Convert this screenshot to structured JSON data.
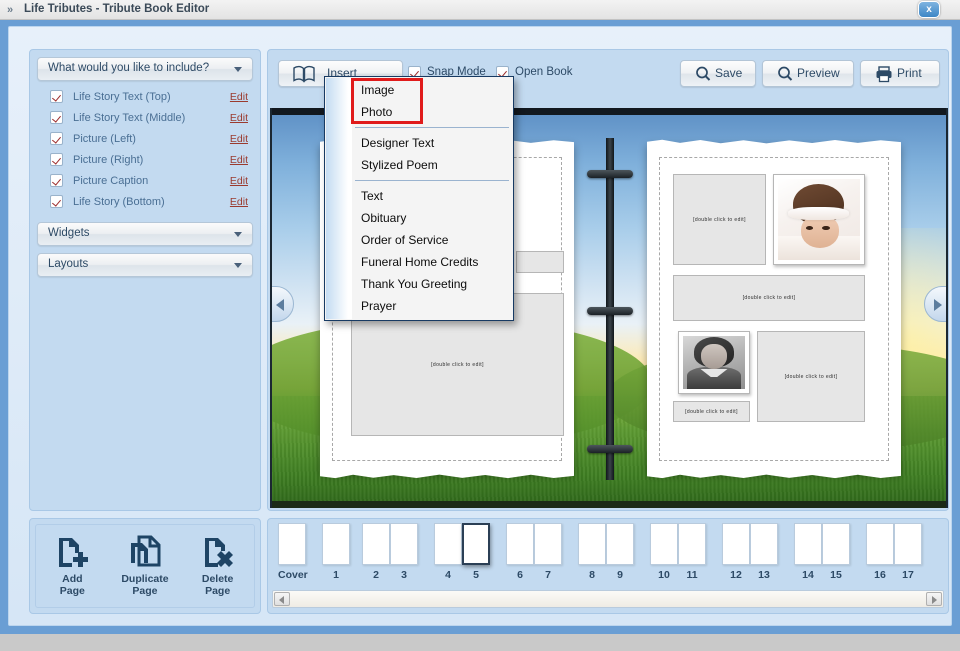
{
  "window": {
    "title": "Life Tributes - Tribute Book Editor",
    "chevrons": "»",
    "close_label": "x"
  },
  "sidebar": {
    "include_header": "What would you like to include?",
    "widgets_header": "Widgets",
    "layouts_header": "Layouts",
    "edit_label": "Edit",
    "items": [
      {
        "label": "Life Story Text (Top)",
        "checked": true
      },
      {
        "label": "Life Story Text (Middle)",
        "checked": true
      },
      {
        "label": "Picture (Left)",
        "checked": true
      },
      {
        "label": "Picture (Right)",
        "checked": true
      },
      {
        "label": "Picture Caption",
        "checked": true
      },
      {
        "label": "Life Story (Bottom)",
        "checked": true
      }
    ]
  },
  "page_actions": [
    {
      "line1": "Add",
      "line2": "Page",
      "icon": "page-plus-icon"
    },
    {
      "line1": "Duplicate",
      "line2": "Page",
      "icon": "page-copy-icon"
    },
    {
      "line1": "Delete",
      "line2": "Page",
      "icon": "page-delete-icon"
    }
  ],
  "toolbar": {
    "insert_label": "Insert",
    "snap_mode_label": "Snap Mode",
    "snap_mode_checked": true,
    "open_book_label": "Open Book",
    "open_book_checked": true,
    "save_label": "Save",
    "preview_label": "Preview",
    "print_label": "Print"
  },
  "insert_menu": {
    "open": true,
    "highlight_color": "#e01b1b",
    "groups": [
      [
        "Image",
        "Photo"
      ],
      [
        "Designer Text",
        "Stylized Poem"
      ],
      [
        "Text",
        "Obituary",
        "Order of Service",
        "Funeral Home Credits",
        "Thank You Greeting",
        "Prayer"
      ]
    ],
    "items": [
      "Image",
      "Photo",
      "Designer Text",
      "Stylized Poem",
      "Text",
      "Obituary",
      "Order of Service",
      "Funeral Home Credits",
      "Thank You Greeting",
      "Prayer"
    ]
  },
  "canvas": {
    "placeholder_text": "[double click to edit]",
    "left_page": {
      "boxes": [
        {
          "name": "small-text-box",
          "text": ""
        },
        {
          "name": "large-text-box",
          "text": "[double click to edit]"
        }
      ]
    },
    "right_page": {
      "boxes": [
        {
          "name": "text-box-top-left",
          "text": "[double click to edit]"
        },
        {
          "name": "photo-baby",
          "text": ""
        },
        {
          "name": "text-box-middle",
          "text": "[double click to edit]"
        },
        {
          "name": "photo-lady",
          "text": ""
        },
        {
          "name": "caption-box",
          "text": "[double click to edit]"
        },
        {
          "name": "text-box-bottom-right",
          "text": "[double click to edit]"
        }
      ]
    },
    "prev_arrow": "◀",
    "next_arrow": "▶"
  },
  "navigator": {
    "selected_page": "5",
    "thumbs": [
      {
        "label": "Cover",
        "selected": false
      },
      {
        "label": "1",
        "selected": false
      },
      {
        "label": "2",
        "selected": false
      },
      {
        "label": "3",
        "selected": false
      },
      {
        "label": "4",
        "selected": false
      },
      {
        "label": "5",
        "selected": true
      },
      {
        "label": "6",
        "selected": false
      },
      {
        "label": "7",
        "selected": false
      },
      {
        "label": "8",
        "selected": false
      },
      {
        "label": "9",
        "selected": false
      },
      {
        "label": "10",
        "selected": false
      },
      {
        "label": "11",
        "selected": false
      },
      {
        "label": "12",
        "selected": false
      },
      {
        "label": "13",
        "selected": false
      },
      {
        "label": "14",
        "selected": false
      },
      {
        "label": "15",
        "selected": false
      },
      {
        "label": "16",
        "selected": false
      },
      {
        "label": "17",
        "selected": false
      }
    ]
  },
  "colors": {
    "panel": "#c3daf0",
    "frame": "#6a9ed4",
    "accent_text": "#2d4a66",
    "link": "#9b3a2e",
    "check": "#9c2b2b"
  }
}
